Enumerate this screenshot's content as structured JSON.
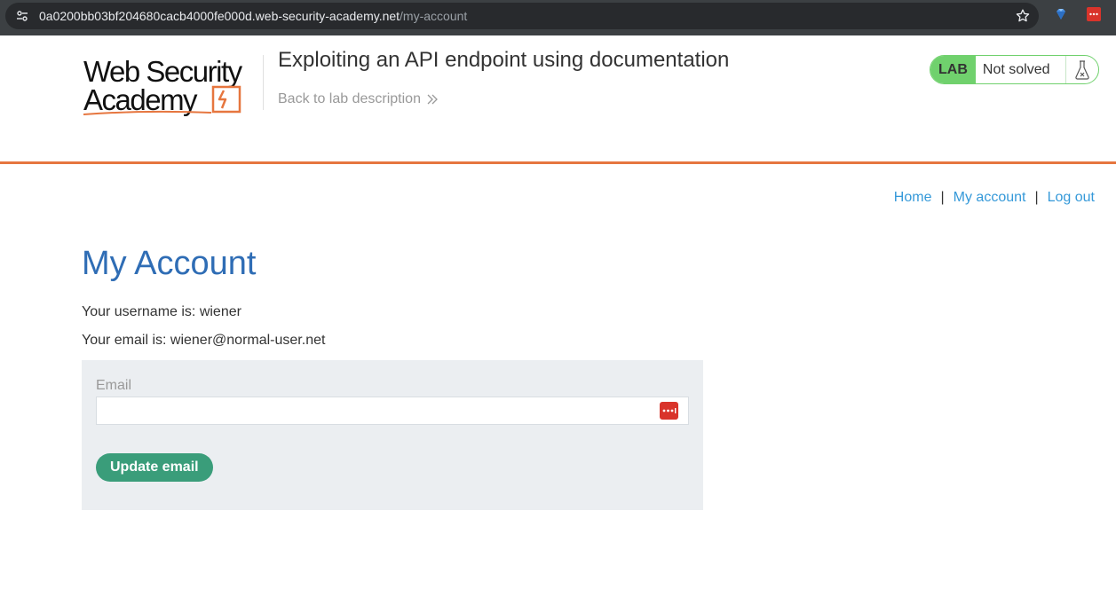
{
  "browser": {
    "url_host": "0a0200bb03bf204680cacb4000fe000d.web-security-academy.net",
    "url_path": "/my-account",
    "icons": [
      "site-info-icon",
      "star-icon",
      "extension-icon",
      "password-manager-extension-icon"
    ]
  },
  "header": {
    "logo_line1": "Web Security",
    "logo_line2": "Academy",
    "lab_title": "Exploiting an API endpoint using documentation",
    "back_link": "Back to lab description",
    "lab_badge": "LAB",
    "lab_status": "Not solved",
    "colors": {
      "accent": "#e6763f",
      "lab_green": "#70d16d"
    }
  },
  "nav": {
    "home": "Home",
    "separator": "|",
    "my_account": "My account",
    "log_out": "Log out"
  },
  "main": {
    "title": "My Account",
    "username_line": "Your username is: wiener",
    "email_line": "Your email is: wiener@normal-user.net",
    "form": {
      "email_label": "Email",
      "email_value": "",
      "submit_label": "Update email"
    },
    "colors": {
      "title": "#2f6db5",
      "button": "#3a9d7a",
      "link": "#3599d9"
    }
  }
}
